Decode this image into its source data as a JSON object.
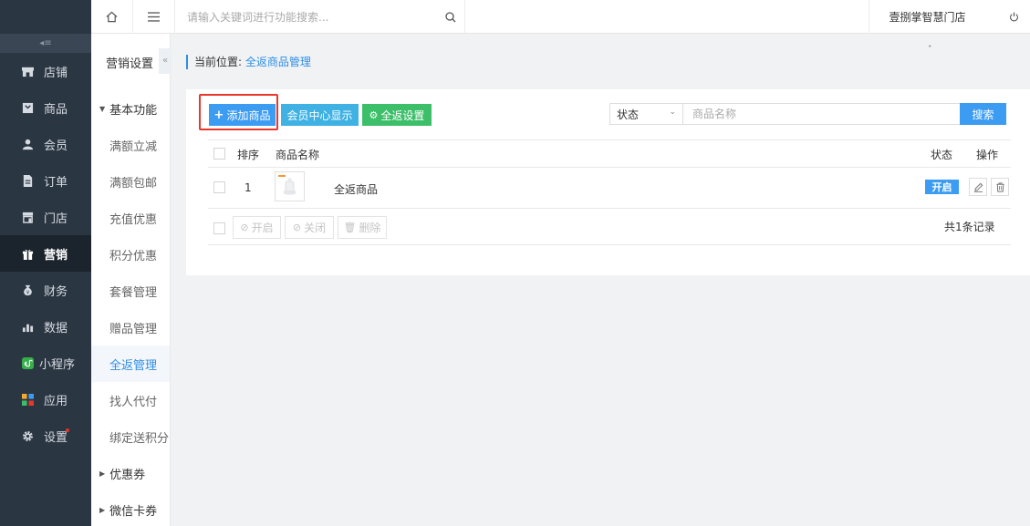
{
  "nav": {
    "collapse_icon": "collapse-menu-icon",
    "items": [
      {
        "label": "店铺",
        "icon": "store-icon"
      },
      {
        "label": "商品",
        "icon": "goods-icon"
      },
      {
        "label": "会员",
        "icon": "user-icon"
      },
      {
        "label": "订单",
        "icon": "order-icon"
      },
      {
        "label": "门店",
        "icon": "shop-icon"
      },
      {
        "label": "营销",
        "icon": "gift-icon",
        "active": true
      },
      {
        "label": "财务",
        "icon": "money-bag-icon"
      },
      {
        "label": "数据",
        "icon": "bar-chart-icon"
      },
      {
        "label": "小程序",
        "icon": "mini-program-icon"
      },
      {
        "label": "应用",
        "icon": "apps-icon"
      },
      {
        "label": "设置",
        "icon": "gear-icon"
      }
    ]
  },
  "topbar": {
    "search_placeholder": "请输入关键词进行功能搜索...",
    "store_name": "壹捌掌智慧门店"
  },
  "submenu": {
    "title": "营销设置",
    "group1": "基本功能",
    "items": [
      "满额立减",
      "满额包邮",
      "充值优惠",
      "积分优惠",
      "套餐管理",
      "赠品管理",
      "全返管理",
      "找人代付",
      "绑定送积分"
    ],
    "active_index": 6,
    "group2": "优惠券",
    "group3": "微信卡券"
  },
  "breadcrumb": {
    "prefix": "当前位置:",
    "current": "全返商品管理"
  },
  "toolbar": {
    "add_label": "添加商品",
    "member_label": "会员中心显示",
    "settings_label": "全返设置",
    "status_select": "状态",
    "name_placeholder": "商品名称",
    "search_label": "搜索"
  },
  "table": {
    "headers": {
      "order": "排序",
      "name": "商品名称",
      "status": "状态",
      "action": "操作"
    },
    "rows": [
      {
        "order": "1",
        "name": "全返商品",
        "status": "开启"
      }
    ],
    "bulk": {
      "enable": "开启",
      "disable": "关闭",
      "delete": "删除"
    },
    "total": "共1条记录"
  },
  "colors": {
    "sidebar_bg": "#2b3643",
    "accent": "#3b9cf2",
    "cyan": "#3fb1e3",
    "green": "#3dbf6a",
    "highlight": "#e8372b"
  }
}
